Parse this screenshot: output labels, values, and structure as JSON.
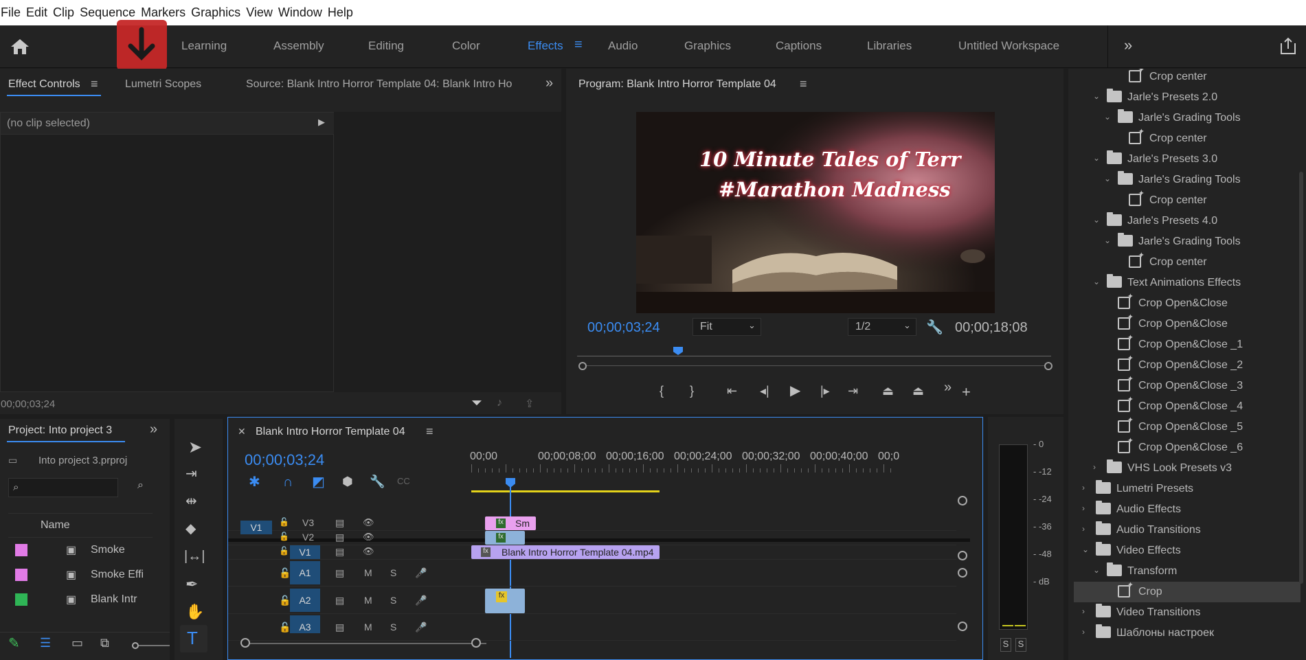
{
  "menu": [
    "File",
    "Edit",
    "Clip",
    "Sequence",
    "Markers",
    "Graphics",
    "View",
    "Window",
    "Help"
  ],
  "workspaces": [
    "Learning",
    "Assembly",
    "Editing",
    "Color",
    "Effects",
    "Audio",
    "Graphics",
    "Captions",
    "Libraries",
    "Untitled Workspace"
  ],
  "active_workspace": "Effects",
  "source_panel": {
    "tabs": [
      "Effect Controls",
      "Lumetri Scopes",
      "Source: Blank Intro Horror Template 04: Blank Intro Ho"
    ],
    "no_clip": "(no clip selected)",
    "timecode": "00;00;03;24"
  },
  "program": {
    "title": "Program: Blank Intro Horror Template 04",
    "video_title_1": "10 Minute Tales of Terr",
    "video_title_2": "#Marathon Madness",
    "timecode": "00;00;03;24",
    "fit": "Fit",
    "resolution": "1/2",
    "duration": "00;00;18;08"
  },
  "project": {
    "tab": "Project: Into project 3",
    "file": "Into project 3.prproj",
    "column": "Name",
    "items": [
      {
        "color": "#e17be6",
        "name": "Smoke"
      },
      {
        "color": "#e17be6",
        "name": "Smoke Effi"
      },
      {
        "color": "#2fb556",
        "name": "Blank Intr"
      }
    ]
  },
  "timeline": {
    "title": "Blank Intro Horror Template 04",
    "timecode": "00;00;03;24",
    "ruler": [
      "00;00",
      "00;00;08;00",
      "00;00;16;00",
      "00;00;24;00",
      "00;00;32;00",
      "00;00;40;00",
      "00;0"
    ],
    "source_patch": "V1",
    "video_tracks": [
      "V3",
      "V2",
      "V1"
    ],
    "audio_tracks": [
      "A1",
      "A2",
      "A3"
    ],
    "mute": "M",
    "solo": "S",
    "clip_v3": "Sm",
    "clip_v1": "Blank Intro Horror Template 04.mp4",
    "fx": "fx"
  },
  "meter": {
    "labels": [
      "0",
      "-12",
      "-24",
      "-36",
      "-48",
      "dB"
    ],
    "solo": [
      "S",
      "S"
    ]
  },
  "effects": [
    {
      "indent": 3,
      "type": "preset",
      "label": "Crop center",
      "arrow": ""
    },
    {
      "indent": 1,
      "type": "folder",
      "label": "Jarle's Presets 2.0",
      "arrow": "⌄"
    },
    {
      "indent": 2,
      "type": "folder",
      "label": "Jarle's Grading Tools",
      "arrow": "⌄"
    },
    {
      "indent": 3,
      "type": "preset",
      "label": "Crop center",
      "arrow": ""
    },
    {
      "indent": 1,
      "type": "folder",
      "label": "Jarle's Presets 3.0",
      "arrow": "⌄"
    },
    {
      "indent": 2,
      "type": "folder",
      "label": "Jarle's Grading Tools",
      "arrow": "⌄"
    },
    {
      "indent": 3,
      "type": "preset",
      "label": "Crop center",
      "arrow": ""
    },
    {
      "indent": 1,
      "type": "folder",
      "label": "Jarle's Presets 4.0",
      "arrow": "⌄"
    },
    {
      "indent": 2,
      "type": "folder",
      "label": "Jarle's Grading Tools",
      "arrow": "⌄"
    },
    {
      "indent": 3,
      "type": "preset",
      "label": "Crop center",
      "arrow": ""
    },
    {
      "indent": 1,
      "type": "folder",
      "label": "Text Animations Effects",
      "arrow": "⌄"
    },
    {
      "indent": 2,
      "type": "preset",
      "label": "Crop Open&Close",
      "arrow": ""
    },
    {
      "indent": 2,
      "type": "preset",
      "label": "Crop Open&Close",
      "arrow": ""
    },
    {
      "indent": 2,
      "type": "preset",
      "label": "Crop Open&Close _1",
      "arrow": ""
    },
    {
      "indent": 2,
      "type": "preset",
      "label": "Crop Open&Close _2",
      "arrow": ""
    },
    {
      "indent": 2,
      "type": "preset",
      "label": "Crop Open&Close _3",
      "arrow": ""
    },
    {
      "indent": 2,
      "type": "preset",
      "label": "Crop Open&Close _4",
      "arrow": ""
    },
    {
      "indent": 2,
      "type": "preset",
      "label": "Crop Open&Close _5",
      "arrow": ""
    },
    {
      "indent": 2,
      "type": "preset",
      "label": "Crop Open&Close _6",
      "arrow": ""
    },
    {
      "indent": 1,
      "type": "folder",
      "label": "VHS Look Presets v3",
      "arrow": "›"
    },
    {
      "indent": 0,
      "type": "folder",
      "label": "Lumetri Presets",
      "arrow": "›"
    },
    {
      "indent": 0,
      "type": "folder",
      "label": "Audio Effects",
      "arrow": "›"
    },
    {
      "indent": 0,
      "type": "folder",
      "label": "Audio Transitions",
      "arrow": "›"
    },
    {
      "indent": 0,
      "type": "folder",
      "label": "Video Effects",
      "arrow": "⌄"
    },
    {
      "indent": 1,
      "type": "folder",
      "label": "Transform",
      "arrow": "⌄"
    },
    {
      "indent": 2,
      "type": "effect",
      "label": "Crop",
      "arrow": ""
    },
    {
      "indent": 0,
      "type": "folder",
      "label": "Video Transitions",
      "arrow": "›"
    },
    {
      "indent": 0,
      "type": "folder",
      "label": "Шаблоны настроек",
      "arrow": "›"
    }
  ],
  "colors": {
    "accent": "#3b8cf2",
    "pink": "#e17be6",
    "purple": "#a88fe0",
    "download": "#c62828"
  }
}
